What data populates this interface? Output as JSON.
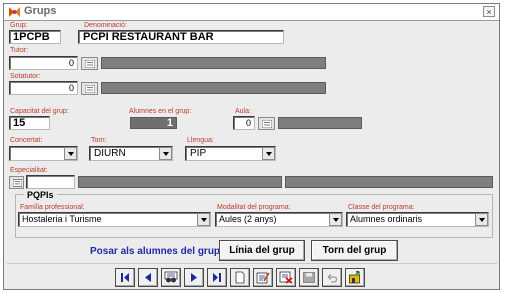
{
  "window": {
    "title": "Grups",
    "close_glyph": "×"
  },
  "grup": {
    "label": "Grup:",
    "value": "1PCPB"
  },
  "denominacio": {
    "label": "Denominació:",
    "value": "PCPI RESTAURANT BAR"
  },
  "tutor": {
    "label": "Tutor:",
    "value": "0"
  },
  "sotatutor": {
    "label": "Sotatutor:",
    "value": "0"
  },
  "capacitat": {
    "label": "Capacitat del grup:",
    "value": "15"
  },
  "alumnes": {
    "label": "Alumnes en el grup:",
    "value": "1"
  },
  "aula": {
    "label": "Aula:",
    "value": "0"
  },
  "concertat": {
    "label": "Concertat:",
    "value": ""
  },
  "torn": {
    "label": "Torn:",
    "value": "DIURN"
  },
  "llengua": {
    "label": "Llengua:",
    "value": "PIP"
  },
  "especialitat": {
    "label": "Especialitat:",
    "value": ""
  },
  "pqpi": {
    "title": "PQPIs",
    "familia": {
      "label": "Família professional:",
      "value": "Hostaleria i Turisme"
    },
    "modalitat": {
      "label": "Modalitat del programa:",
      "value": "Aules (2 anys)"
    },
    "classe": {
      "label": "Classe del programa:",
      "value": "Alumnes ordinaris"
    }
  },
  "actions": {
    "posar_label": "Posar als alumnes del grup",
    "linia_button": "Línia del grup",
    "torn_button": "Torn del grup"
  },
  "icons": [
    "first-record-icon",
    "previous-record-icon",
    "search-binoculars-icon",
    "next-record-icon",
    "last-record-icon",
    "new-record-icon",
    "edit-record-icon",
    "delete-record-icon",
    "save-record-icon",
    "undo-icon",
    "exit-icon"
  ],
  "colors": {
    "label_red": "#c0392b",
    "link_blue": "#1f2aa6",
    "nav_blue": "#1a2a9a"
  }
}
